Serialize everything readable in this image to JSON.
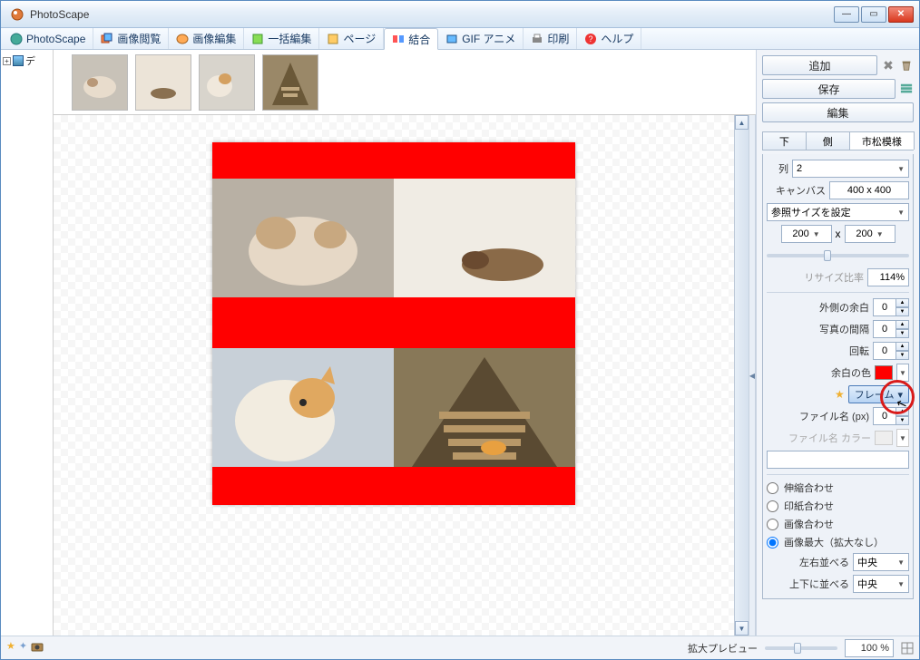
{
  "app": {
    "title": "PhotoScape"
  },
  "tabs": [
    {
      "label": "PhotoScape"
    },
    {
      "label": "画像閲覧"
    },
    {
      "label": "画像編集"
    },
    {
      "label": "一括編集"
    },
    {
      "label": "ページ"
    },
    {
      "label": "結合"
    },
    {
      "label": "GIF アニメ"
    },
    {
      "label": "印刷"
    },
    {
      "label": "ヘルプ"
    }
  ],
  "tree": {
    "root": "デ"
  },
  "right": {
    "add": "追加",
    "save": "保存",
    "edit": "編集",
    "subtabs": {
      "down": "下",
      "side": "側",
      "checker": "市松模様"
    },
    "cols_label": "列",
    "cols_value": "2",
    "canvas_label": "キャンバス",
    "canvas_value": "400 x 400",
    "refsize": "参照サイズを設定",
    "cell_w": "200",
    "x": "x",
    "cell_h": "200",
    "resize_label": "リサイズ比率",
    "resize_value": "114%",
    "margin_out_label": "外側の余白",
    "margin_out": "0",
    "gap_label": "写真の間隔",
    "gap": "0",
    "rotate_label": "回転",
    "rotate": "0",
    "bgcolor_label": "余白の色",
    "bgcolor": "#ff0000",
    "frame_btn": "フレーム",
    "filename_px_label": "ファイル名 (px)",
    "filename_px": "0",
    "filename_color_label": "ファイル名 カラー",
    "fit_stretch": "伸縮合わせ",
    "fit_paper": "印紙合わせ",
    "fit_image": "画像合わせ",
    "fit_max": "画像最大（拡大なし）",
    "halign_label": "左右並べる",
    "halign": "中央",
    "valign_label": "上下に並べる",
    "valign": "中央"
  },
  "status": {
    "zoom_label": "拡大プレビュー",
    "zoom": "100 %"
  }
}
